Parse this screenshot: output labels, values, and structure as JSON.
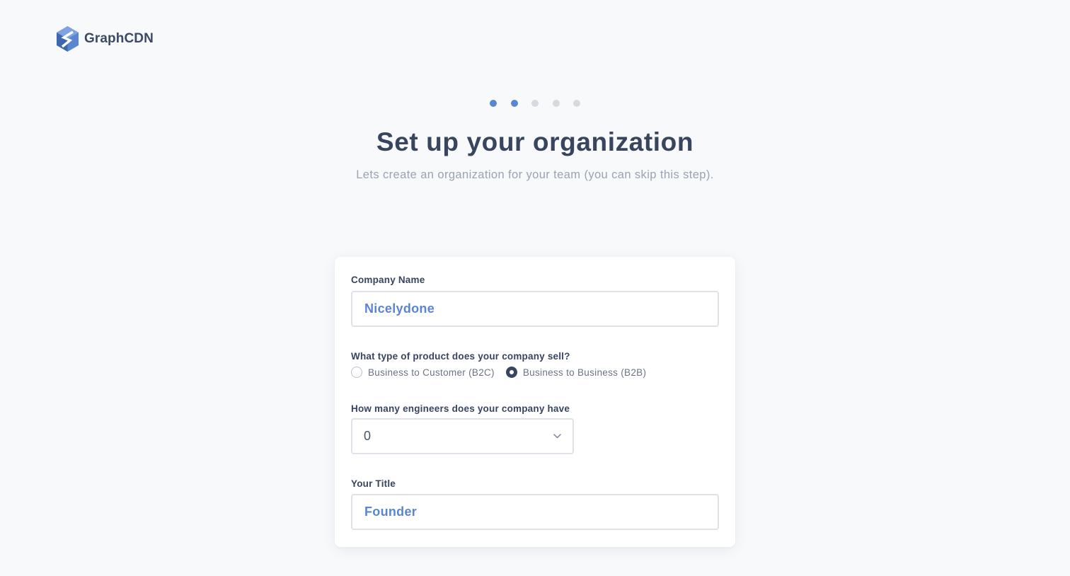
{
  "brand": {
    "name": "GraphCDN",
    "icon": "graphcdn-logo-icon"
  },
  "steps": {
    "total": 5,
    "current": 2
  },
  "header": {
    "title": "Set up your organization",
    "subtitle": "Lets create an organization for your team (you can skip this step)."
  },
  "form": {
    "company_name": {
      "label": "Company Name",
      "value": "Nicelydone"
    },
    "product_type": {
      "label": "What type of product does your company sell?",
      "options": [
        {
          "label": "Business to Customer (B2C)",
          "selected": false
        },
        {
          "label": "Business to Business (B2B)",
          "selected": true
        }
      ]
    },
    "engineers": {
      "label": "How many engineers does your company have",
      "value": "0",
      "icon": "chevron-down-icon"
    },
    "title": {
      "label": "Your Title",
      "value": "Founder"
    }
  },
  "colors": {
    "accent": "#5a85d0",
    "heading": "#38455f",
    "muted": "#9aa3b4",
    "inactive_dot": "#d5d9e0",
    "background": "#f8f9fb"
  }
}
